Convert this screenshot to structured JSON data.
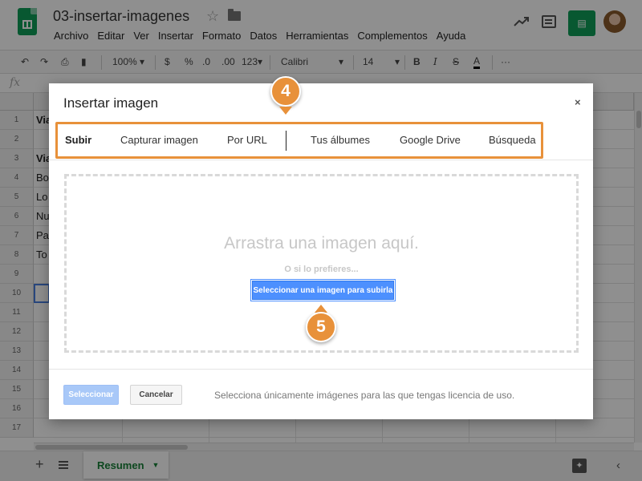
{
  "app": {
    "doc_title": "03-insertar-imagenes",
    "menu": [
      "Archivo",
      "Editar",
      "Ver",
      "Insertar",
      "Formato",
      "Datos",
      "Herramientas",
      "Complementos",
      "Ayuda"
    ]
  },
  "toolbar": {
    "zoom": "100%",
    "currency": "$",
    "percent": "%",
    "decrease_decimals": ".0",
    "increase_decimals": ".00",
    "more_formats": "123",
    "font": "Calibri",
    "font_size": "14",
    "bold": "B",
    "italic": "I",
    "strikethrough": "S",
    "text_color": "A",
    "more": "···"
  },
  "formula_bar": {
    "label": "fx"
  },
  "grid": {
    "rows": [
      "1",
      "2",
      "3",
      "4",
      "5",
      "6",
      "7",
      "8",
      "9",
      "10",
      "11",
      "12",
      "13",
      "14",
      "15",
      "16",
      "17"
    ],
    "visible_cells": [
      {
        "row": "1",
        "text": "Via",
        "bold": true
      },
      {
        "row": "3",
        "text": "Via",
        "bold": true
      },
      {
        "row": "4",
        "text": "Bo",
        "bold": false
      },
      {
        "row": "5",
        "text": "Lo",
        "bold": false
      },
      {
        "row": "6",
        "text": "Nu",
        "bold": false
      },
      {
        "row": "7",
        "text": "Pa",
        "bold": false
      },
      {
        "row": "8",
        "text": "To",
        "bold": false
      }
    ]
  },
  "sheets": {
    "active_tab": "Resumen"
  },
  "dialog": {
    "title": "Insertar imagen",
    "close": "×",
    "tabs": [
      "Subir",
      "Capturar imagen",
      "Por URL",
      "Tus álbumes",
      "Google Drive",
      "Búsqueda"
    ],
    "active_tab": "Subir",
    "drop_heading": "Arrastra una imagen aquí.",
    "drop_sub": "O si lo prefieres...",
    "upload_button": "Seleccionar una imagen para subirla",
    "select_button": "Seleccionar",
    "cancel_button": "Cancelar",
    "license_note": "Selecciona únicamente imágenes para las que tengas licencia de uso."
  },
  "callouts": {
    "step_4": "4",
    "step_5": "5"
  },
  "colors": {
    "accent_orange": "#e8913a",
    "sheets_green": "#0f9d58",
    "button_blue": "#4d90fe",
    "disabled_blue": "#a8c8f8"
  }
}
